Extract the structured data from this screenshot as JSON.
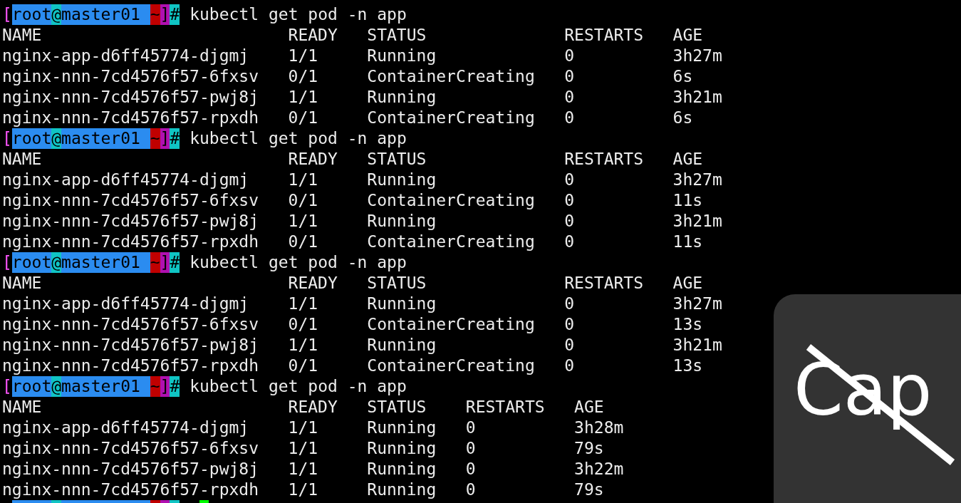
{
  "blocks": [
    {
      "prompt": {
        "open": "[",
        "user": "root",
        "at": "@",
        "host": "master01",
        "dir": "~",
        "close": "]",
        "sign": "#"
      },
      "command": "kubectl get pod -n app",
      "columns": [
        "NAME",
        "READY",
        "STATUS",
        "RESTARTS",
        "AGE"
      ],
      "rows": [
        [
          "nginx-app-d6ff45774-djgmj",
          "1/1",
          "Running",
          "0",
          "3h27m"
        ],
        [
          "nginx-nnn-7cd4576f57-6fxsv",
          "0/1",
          "ContainerCreating",
          "0",
          "6s"
        ],
        [
          "nginx-nnn-7cd4576f57-pwj8j",
          "1/1",
          "Running",
          "0",
          "3h21m"
        ],
        [
          "nginx-nnn-7cd4576f57-rpxdh",
          "0/1",
          "ContainerCreating",
          "0",
          "6s"
        ]
      ]
    },
    {
      "prompt": {
        "open": "[",
        "user": "root",
        "at": "@",
        "host": "master01",
        "dir": "~",
        "close": "]",
        "sign": "#"
      },
      "command": "kubectl get pod -n app",
      "columns": [
        "NAME",
        "READY",
        "STATUS",
        "RESTARTS",
        "AGE"
      ],
      "rows": [
        [
          "nginx-app-d6ff45774-djgmj",
          "1/1",
          "Running",
          "0",
          "3h27m"
        ],
        [
          "nginx-nnn-7cd4576f57-6fxsv",
          "0/1",
          "ContainerCreating",
          "0",
          "11s"
        ],
        [
          "nginx-nnn-7cd4576f57-pwj8j",
          "1/1",
          "Running",
          "0",
          "3h21m"
        ],
        [
          "nginx-nnn-7cd4576f57-rpxdh",
          "0/1",
          "ContainerCreating",
          "0",
          "11s"
        ]
      ]
    },
    {
      "prompt": {
        "open": "[",
        "user": "root",
        "at": "@",
        "host": "master01",
        "dir": "~",
        "close": "]",
        "sign": "#"
      },
      "command": "kubectl get pod -n app",
      "columns": [
        "NAME",
        "READY",
        "STATUS",
        "RESTARTS",
        "AGE"
      ],
      "rows": [
        [
          "nginx-app-d6ff45774-djgmj",
          "1/1",
          "Running",
          "0",
          "3h27m"
        ],
        [
          "nginx-nnn-7cd4576f57-6fxsv",
          "0/1",
          "ContainerCreating",
          "0",
          "13s"
        ],
        [
          "nginx-nnn-7cd4576f57-pwj8j",
          "1/1",
          "Running",
          "0",
          "3h21m"
        ],
        [
          "nginx-nnn-7cd4576f57-rpxdh",
          "0/1",
          "ContainerCreating",
          "0",
          "13s"
        ]
      ]
    },
    {
      "prompt": {
        "open": "[",
        "user": "root",
        "at": "@",
        "host": "master01",
        "dir": "~",
        "close": "]",
        "sign": "#"
      },
      "command": "kubectl get pod -n app",
      "columns": [
        "NAME",
        "READY",
        "STATUS",
        "RESTARTS",
        "AGE"
      ],
      "rows": [
        [
          "nginx-app-d6ff45774-djgmj",
          "1/1",
          "Running",
          "0",
          "3h28m"
        ],
        [
          "nginx-nnn-7cd4576f57-6fxsv",
          "1/1",
          "Running",
          "0",
          "79s"
        ],
        [
          "nginx-nnn-7cd4576f57-pwj8j",
          "1/1",
          "Running",
          "0",
          "3h22m"
        ],
        [
          "nginx-nnn-7cd4576f57-rpxdh",
          "1/1",
          "Running",
          "0",
          "79s"
        ]
      ]
    }
  ],
  "caps_lock_indicator": {
    "label": "Cap"
  }
}
